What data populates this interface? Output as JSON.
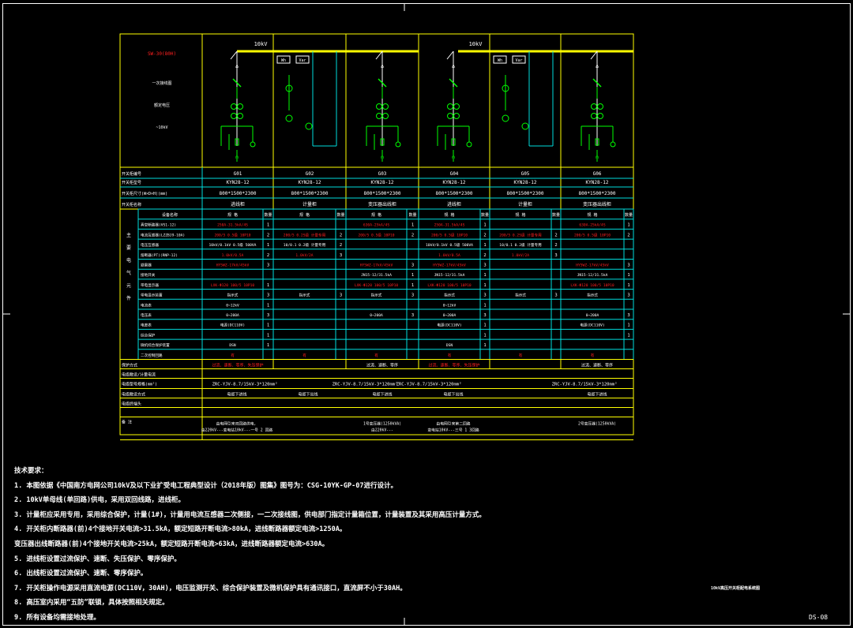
{
  "drawing": {
    "left_title_red": "SW-30(80H)",
    "left_labels": [
      "一次接线图",
      "额定电压",
      "~10kV"
    ],
    "bus_labels": [
      "10kV",
      "10kV"
    ],
    "meter_labels": [
      "Wh",
      "Var",
      "Wh",
      "Var"
    ],
    "drawing_title": "10kV高压开关柜配电系统图",
    "drawing_number": "DS-08"
  },
  "table": {
    "row_labels": [
      "开关柜编号",
      "开关柜型号",
      "开关柜尺寸(W×D×H)(mm)",
      "开关柜名称"
    ],
    "cabinet_numbers": [
      "G01",
      "G02",
      "G03",
      "G04",
      "G05",
      "G06"
    ],
    "cabinet_models": [
      "KYN28-12",
      "KYN28-12",
      "KYN28-12",
      "KYN28-12",
      "KYN28-12",
      "KYN28-12"
    ],
    "cabinet_sizes": [
      "800*1500*2300",
      "800*1500*2300",
      "800*1500*2300",
      "800*1500*2300",
      "800*1500*2300",
      "800*1500*2300"
    ],
    "cabinet_names": [
      "进线柜",
      "计量柜",
      "变压器出线柜",
      "进线柜",
      "计量柜",
      "变压器出线柜"
    ],
    "main_equipment_label": [
      "主",
      "要",
      "电",
      "气",
      "元",
      "件"
    ],
    "equip_header": [
      "设备名称",
      "规 格",
      "数量",
      "规 格",
      "数量",
      "规 格",
      "数量",
      "规 格",
      "数量",
      "规 格",
      "数量",
      "规 格",
      "数量"
    ],
    "equip_names": [
      "真空断路器(VS1-12)",
      "电流互感器(LZZBJ9-10A)",
      "电压互感器",
      "熔断器(PT)(RNP-12)",
      "避雷器",
      "接地开关",
      "带电显示器",
      "带电显示装置",
      "电流表",
      "电压表",
      "电度表",
      "综合保护",
      "微机综合保护装置",
      "二次控制回路",
      "无功补偿"
    ],
    "rows": [
      [
        "250A-31.5kA/4S",
        "1",
        "",
        "",
        "630A-25kA/4S",
        "1",
        "250A-31.5kA/4S",
        "1",
        "",
        "",
        "630A-25kA/4S",
        "1"
      ],
      [
        "200/5 0.5级 10P10",
        "2",
        "200/5 0.2S级 计量专用",
        "2",
        "200/5 0.5级 10P10",
        "2",
        "200/5 0.5级 10P10",
        "2",
        "200/5 0.2S级 计量专用",
        "2",
        "200/5 0.5级 10P10",
        "2"
      ],
      [
        "10kV/0.1kV 0.5级 500VA",
        "1",
        "10/0.1 0.2级 计量专用",
        "2",
        "",
        "",
        "10kV/0.1kV 0.5级 500VA",
        "1",
        "10/0.1 0.2级 计量专用",
        "2",
        "",
        ""
      ],
      [
        "1.0kV/0.5A",
        "2",
        "1.0kV/2A",
        "3",
        "",
        "",
        "1.0kV/0.5A",
        "2",
        "1.0kV/2A",
        "3",
        "",
        ""
      ],
      [
        "HY5WZ-17kV/45kV",
        "3",
        "",
        "",
        "HY5WZ-17kV/45kV",
        "3",
        "HY5WZ-17kV/45kV",
        "3",
        "",
        "",
        "HY5WZ-17kV/45kV",
        "3"
      ],
      [
        "",
        "",
        "",
        "",
        "JN15-12/31.5kA",
        "1",
        "JN15-12/31.5kA",
        "1",
        "",
        "",
        "JN15-12/31.5kA",
        "1"
      ],
      [
        "LXK-Φ120 100/5 10P10",
        "1",
        "",
        "",
        "LXK-Φ120 100/5 10P10",
        "1",
        "LXK-Φ120 100/5 10P10",
        "1",
        "",
        "",
        "LXK-Φ120 100/5 10P10",
        "1"
      ],
      [
        "指示式",
        "3",
        "指示式",
        "3",
        "指示式",
        "3",
        "指示式",
        "3",
        "指示式",
        "3",
        "指示式",
        "3"
      ],
      [
        "0~12kV",
        "1",
        "",
        "",
        "",
        "",
        "0~12kV",
        "1",
        "",
        "",
        "",
        ""
      ],
      [
        "0~200A",
        "3",
        "",
        "",
        "0~200A",
        "3",
        "0~200A",
        "3",
        "",
        "",
        "0~200A",
        "3"
      ],
      [
        "电源(DC110V)",
        "1",
        "",
        "",
        "",
        "",
        "电源(DC110V)",
        "1",
        "",
        "",
        "电源(DC110V)",
        "1"
      ],
      [
        "",
        "1",
        "",
        "",
        "",
        "",
        "",
        "1",
        "",
        "",
        "",
        "1"
      ],
      [
        "DSN",
        "1",
        "",
        "",
        "",
        "",
        "DSN",
        "1",
        "",
        "",
        "",
        ""
      ],
      [
        "有",
        "",
        "有",
        "",
        "有",
        "",
        "有",
        "",
        "有",
        "",
        "有",
        ""
      ]
    ],
    "lower_labels": [
      "保护方式",
      "电缆敷设/计量电流",
      "电缆型号规格(mm²)",
      "电缆敷设方式",
      "电缆终端头",
      "备 注"
    ],
    "protection": [
      "过流、速断、零序、失压保护",
      "",
      "过流、速断、零序",
      "过流、速断、零序、失压保护",
      "",
      "过流、速断、零序"
    ],
    "cables": [
      "ZRC-YJV-8.7/15kV-3*120mm²",
      "ZRC-YJV-8.7/15kV-3*120mm²",
      "ZRC-YJV-8.7/15kV-3*120mm²",
      "ZRC-YJV-8.7/15kV-3*120mm²"
    ],
    "cable_method": [
      "电缆下进线",
      "电缆下进线",
      "电缆下出线",
      "电缆下进线",
      "电缆下出线"
    ],
    "remarks": [
      "由电网引来双回路供电，\n由220kV---变电站10kV---一号 2 回路",
      "1号变压器(1250kVA)\n由220kV---",
      "由电网引来第二回路\n变电站10kV---三号 1 3回路",
      "2号变压器(1250kVA)"
    ]
  },
  "notes": {
    "heading": "技术要求：",
    "items": [
      "1. 本图依据《中国南方电网公司10kV及以下业扩受电工程典型设计（2018年版）图集》图号为：CSG-10YK-GP-07进行设计。",
      "2. 10kV单母线(单回路)供电，采用双回线路，进线柜。",
      "3. 计量柜应采用专用，采用综合保护，计量(1#)，计量用电流互感器二次侧接，一二次接线图，供电部门指定计量箱位置，计量装置及其采用高压计量方式。",
      "4. 开关柜内断路器(前)4个接地开关电流>31.5kA，额定短路开断电流>80kA，进线断路器额定电流>1250A。",
      "   变压器出线断路器(前)4个接地开关电流>25kA，额定短路开断电流>63kA，进线断路器额定电流>630A。",
      "5. 进线柜设置过流保护、速断、失压保护、零序保护。",
      "6. 出线柜设置过流保护、速断、零序保护。",
      "7. 开关柜操作电源采用直流电源(DC110V，30AH)，电压监测开关、综合保护装置及微机保护具有通讯接口，直流屏不小于30AH。",
      "8. 高压室内采用“五防”联锁，具体按照相关规定。",
      "9. 所有设备均需接地处理。"
    ]
  }
}
